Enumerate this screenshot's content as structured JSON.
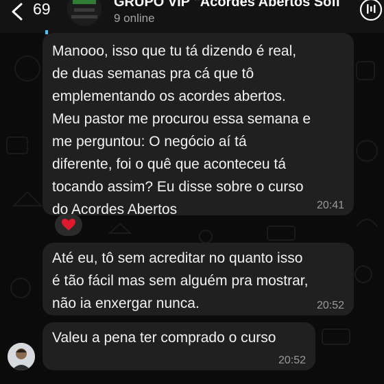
{
  "header": {
    "unread_count": "69",
    "group_name": "GRUPO VIP \"Acordes Abertos Sofi",
    "online_status": "9 online",
    "group_avatar_text": [
      "ACORDES",
      "ABERTOS",
      "SOFISTICADOS"
    ]
  },
  "messages": [
    {
      "text": "Manooo, isso que tu tá dizendo é real,\nde duas semanas pra cá que tô\nemplementando os acordes abertos.\nMeu pastor me procurou essa semana e\nme perguntou: O negócio aí tá\ndiferente, foi o quê que aconteceu tá\ntocando assim? Eu disse sobre o curso\ndo Acordes Abertos",
      "time": "20:41",
      "reaction": "heart"
    },
    {
      "text": "Até eu, tô sem acreditar no quanto isso\né tão fácil mas sem alguém pra mostrar,\nnão ia enxergar nunca.",
      "time": "20:52"
    },
    {
      "text": "Valeu a pena ter comprado o curso",
      "time": "20:52"
    }
  ],
  "colors": {
    "header_bg": "#131313",
    "bubble_bg": "#202020",
    "chat_bg": "#0b0b0b",
    "accent": "#46c2ff",
    "reaction": "#e0182d"
  },
  "icons": [
    "back-chevron-icon",
    "group-avatar",
    "call-icon",
    "heart-reaction-icon",
    "sender-avatar"
  ]
}
